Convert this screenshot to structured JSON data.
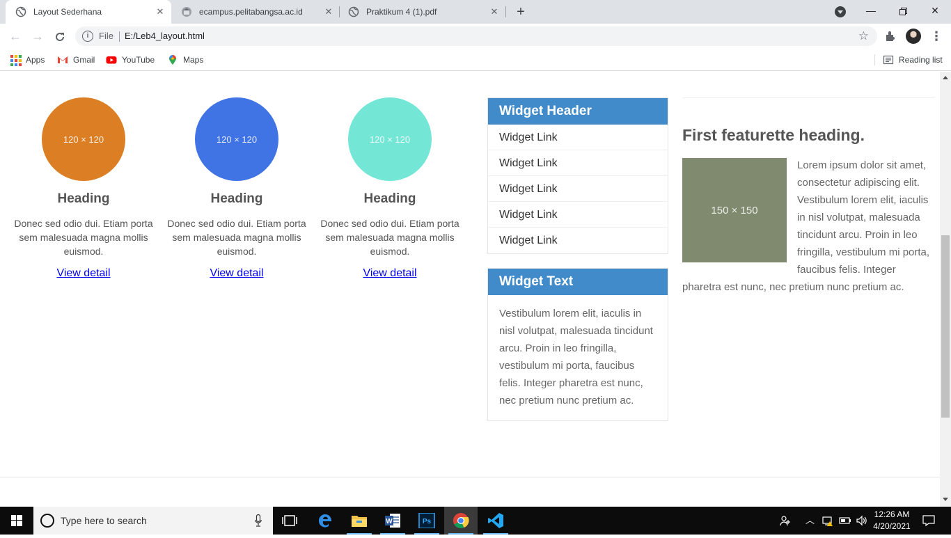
{
  "browser": {
    "tabs": [
      {
        "title": "Layout Sederhana",
        "active": true
      },
      {
        "title": "ecampus.pelitabangsa.ac.id",
        "active": false
      },
      {
        "title": "Praktikum 4 (1).pdf",
        "active": false
      }
    ],
    "new_tab_label": "+",
    "omnibox": {
      "scheme_label": "File",
      "url": "E:/Leb4_layout.html"
    },
    "bookmarks": [
      {
        "label": "Apps",
        "icon": "apps-grid-icon"
      },
      {
        "label": "Gmail",
        "icon": "gmail-icon"
      },
      {
        "label": "YouTube",
        "icon": "youtube-icon"
      },
      {
        "label": "Maps",
        "icon": "maps-icon"
      }
    ],
    "reading_list_label": "Reading list"
  },
  "page": {
    "columns": [
      {
        "placeholder": "120 × 120",
        "color": "#dc7e24",
        "heading": "Heading",
        "text": "Donec sed odio dui. Etiam porta sem malesuada magna mollis euismod.",
        "link": "View detail"
      },
      {
        "placeholder": "120 × 120",
        "color": "#4073e4",
        "heading": "Heading",
        "text": "Donec sed odio dui. Etiam porta sem malesuada magna mollis euismod.",
        "link": "View detail"
      },
      {
        "placeholder": "120 × 120",
        "color": "#73e6d6",
        "heading": "Heading",
        "text": "Donec sed odio dui. Etiam porta sem malesuada magna mollis euismod.",
        "link": "View detail"
      }
    ],
    "widget_links": {
      "header": "Widget Header",
      "links": [
        "Widget Link",
        "Widget Link",
        "Widget Link",
        "Widget Link",
        "Widget Link"
      ]
    },
    "widget_text": {
      "header": "Widget Text",
      "body": "Vestibulum lorem elit, iaculis in nisl volutpat, malesuada tincidunt arcu. Proin in leo fringilla, vestibulum mi porta, faucibus felis. Integer pharetra est nunc, nec pretium nunc pretium ac."
    },
    "featurette": {
      "heading": "First featurette heading.",
      "image_placeholder": "150 × 150",
      "body": "Lorem ipsum dolor sit amet, consectetur adipiscing elit. Vestibulum lorem elit, iaculis in nisl volutpat, malesuada tincidunt arcu. Proin in leo fringilla, vestibulum mi porta, faucibus felis. Integer pharetra est nunc, nec pretium nunc pretium ac."
    },
    "accent_color": "#428bca",
    "link_color": "#0000ee"
  },
  "taskbar": {
    "search_placeholder": "Type here to search",
    "apps": [
      "task-view-icon",
      "edge-icon",
      "file-explorer-icon",
      "word-icon",
      "photoshop-icon",
      "chrome-icon",
      "vscode-icon"
    ],
    "active_app": "chrome-icon",
    "time": "12:26 AM",
    "date": "4/20/2021"
  }
}
